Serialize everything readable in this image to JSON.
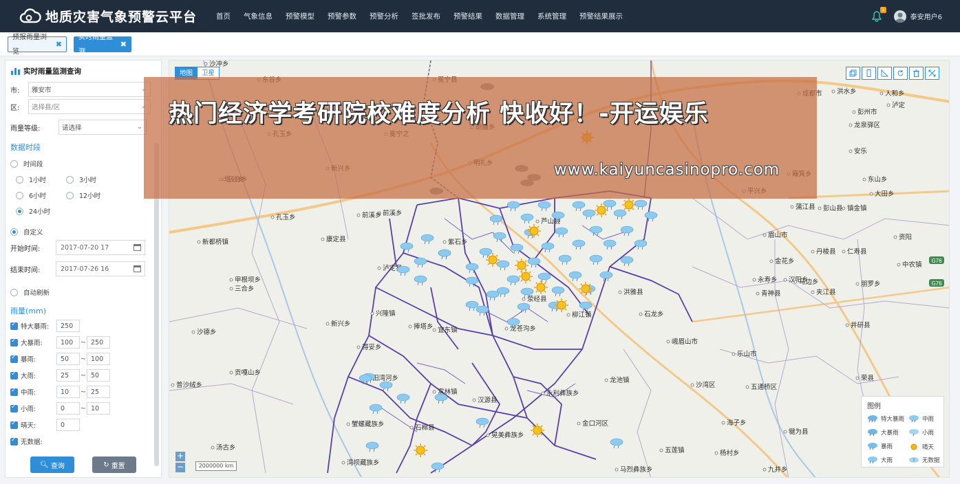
{
  "app": {
    "title": "地质灾害气象预警云平台",
    "nav": [
      "首页",
      "气象信息",
      "预警模型",
      "预警参数",
      "预警分析",
      "签批发布",
      "预警结果",
      "数据管理",
      "系统管理",
      "预警结果展示"
    ],
    "notifications": "1",
    "user": "泰安用户6"
  },
  "tabs": [
    {
      "label": "预报雨量浏览",
      "close": "✖"
    },
    {
      "label": "实时雨量监测",
      "close": "✖"
    }
  ],
  "panel": {
    "title": "实时雨量监测查询",
    "city_label": "市:",
    "city_value": "雅安市",
    "district_label": "区:",
    "district_placeholder": "选择县/区",
    "grade_label": "雨量等级:",
    "grade_value": "请选择",
    "period_title": "数据时段",
    "time_period": "时间段",
    "options": [
      "1小时",
      "3小时",
      "6小时",
      "12小时",
      "24小时"
    ],
    "custom": "自定义",
    "start_label": "开始时间:",
    "start_value": "2017-07-20 17",
    "end_label": "结束时间:",
    "end_value": "2017-07-26 16",
    "auto_refresh": "自动刷新",
    "rain_title": "雨量(mm)",
    "rain_rows": [
      {
        "label": "特大暴雨:",
        "min": "250",
        "max": ""
      },
      {
        "label": "大暴雨:",
        "min": "100",
        "max": "250"
      },
      {
        "label": "暴雨:",
        "min": "50",
        "max": "100"
      },
      {
        "label": "大雨:",
        "min": "25",
        "max": "50"
      },
      {
        "label": "中雨:",
        "min": "10",
        "max": "25"
      },
      {
        "label": "小雨:",
        "min": "0",
        "max": "10"
      },
      {
        "label": "晴天:",
        "min": "0",
        "max": ""
      },
      {
        "label": "无数据:",
        "min": "",
        "max": ""
      }
    ],
    "dash": "~",
    "query_button": "查询",
    "reset_button": "重置"
  },
  "map": {
    "type_map": "地图",
    "type_sat": "卫星",
    "scale": "2000000 km",
    "zoom_in": "+",
    "zoom_out": "−",
    "places": [
      "沙冲乡",
      "东谷乡",
      "冕宁县",
      "成都市",
      "洪水乡",
      "人和乡",
      "泸定",
      "孔玉乡",
      "龙泉驿区",
      "彭州市",
      "冕宁之",
      "前溪乡",
      "新都桥镇",
      "康定县",
      "紫石乡",
      "芦山县",
      "蒲江县",
      "彭山县",
      "镇金镇",
      "资阳",
      "丹棱县",
      "仁寿县",
      "眉山市",
      "金花乡",
      "中农镇",
      "永寿乡",
      "汉阳乡",
      "甲根坝乡",
      "三合乡",
      "荥经县",
      "洪雅县",
      "青神县",
      "夹江县",
      "新兴乡",
      "兴隆镇",
      "龙苍沟乡",
      "柳江镇",
      "石龙乡",
      "井研县",
      "峨眉山市",
      "乐山市",
      "宜东镇",
      "得妥乡",
      "贡嘎山乡",
      "普沙绒乡",
      "田湾河乡",
      "富林镇",
      "汉源县",
      "永利彝族乡",
      "龙池镇",
      "沙湾区",
      "五通桥区",
      "荣县",
      "蟹螺藏族乡",
      "金口河区",
      "石棉县",
      "晃美彝族乡",
      "汤古乡",
      "海子乡",
      "犍为县",
      "湾坝藏族乡",
      "马烈彝族乡",
      "杨村乡",
      "九井乡",
      "五莲镇",
      "沙德乡",
      "新兴乡",
      "三合乡",
      "泸定县",
      "捧塔乡",
      "朋罗乡",
      "马边乡",
      "大田乡",
      "东山乡",
      "安乐",
      "簸箕乡",
      "平兴乡",
      "前溪乡",
      "孔玉乡",
      "明礼乡",
      "塔公乡",
      "硕曲乡"
    ],
    "banner_title": "热门经济学考研院校难度分析 快收好！-开运娱乐",
    "banner_url": "www.kaiyuncasinopro.com",
    "legend_title": "图例",
    "legend": [
      "特大暴雨",
      "中雨",
      "大暴雨",
      "小雨",
      "暴雨",
      "晴天",
      "大雨",
      "无数据"
    ]
  }
}
